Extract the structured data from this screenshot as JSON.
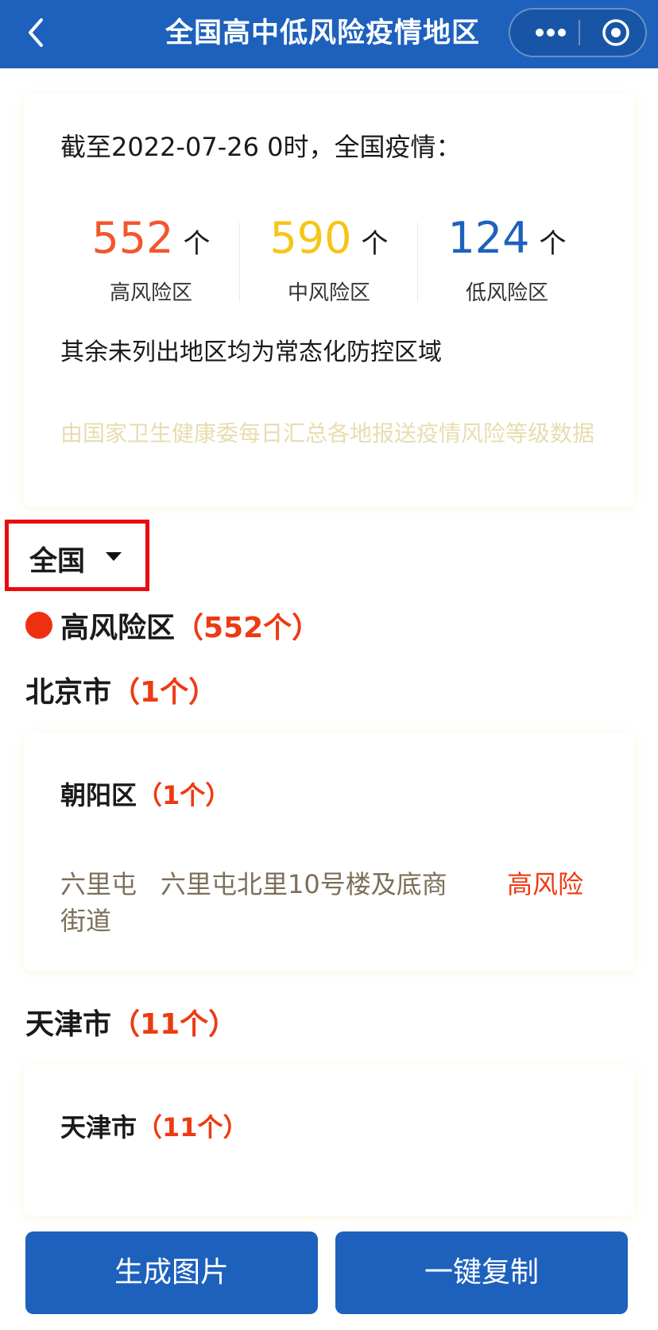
{
  "nav": {
    "title": "全国高中低风险疫情地区"
  },
  "summary": {
    "as_of": "截至2022-07-26 0时，全国疫情：",
    "stats": [
      {
        "value": "552",
        "unit": "个",
        "label": "高风险区",
        "color": "#f2562d"
      },
      {
        "value": "590",
        "unit": "个",
        "label": "中风险区",
        "color": "#f5c518"
      },
      {
        "value": "124",
        "unit": "个",
        "label": "低风险区",
        "color": "#1d61bd"
      }
    ],
    "note": "其余未列出地区均为常态化防控区域",
    "source": "由国家卫生健康委每日汇总各地报送疫情风险等级数据"
  },
  "filter": {
    "region": "全国"
  },
  "high_risk": {
    "name": "高风险区",
    "count_text": "（552个）",
    "dot_color": "#ee2f10"
  },
  "cities": [
    {
      "name": "北京市",
      "count_text": "（1个）",
      "district": "朝阳区",
      "district_count_text": "（1个）",
      "street": "六里屯街道",
      "address": "六里屯北里10号楼及底商",
      "risk": "高风险"
    },
    {
      "name": "天津市",
      "count_text": "（11个）",
      "district": "天津市",
      "district_count_text": "（11个）"
    }
  ],
  "buttons": {
    "generate_image": "生成图片",
    "copy_all": "一键复制"
  }
}
